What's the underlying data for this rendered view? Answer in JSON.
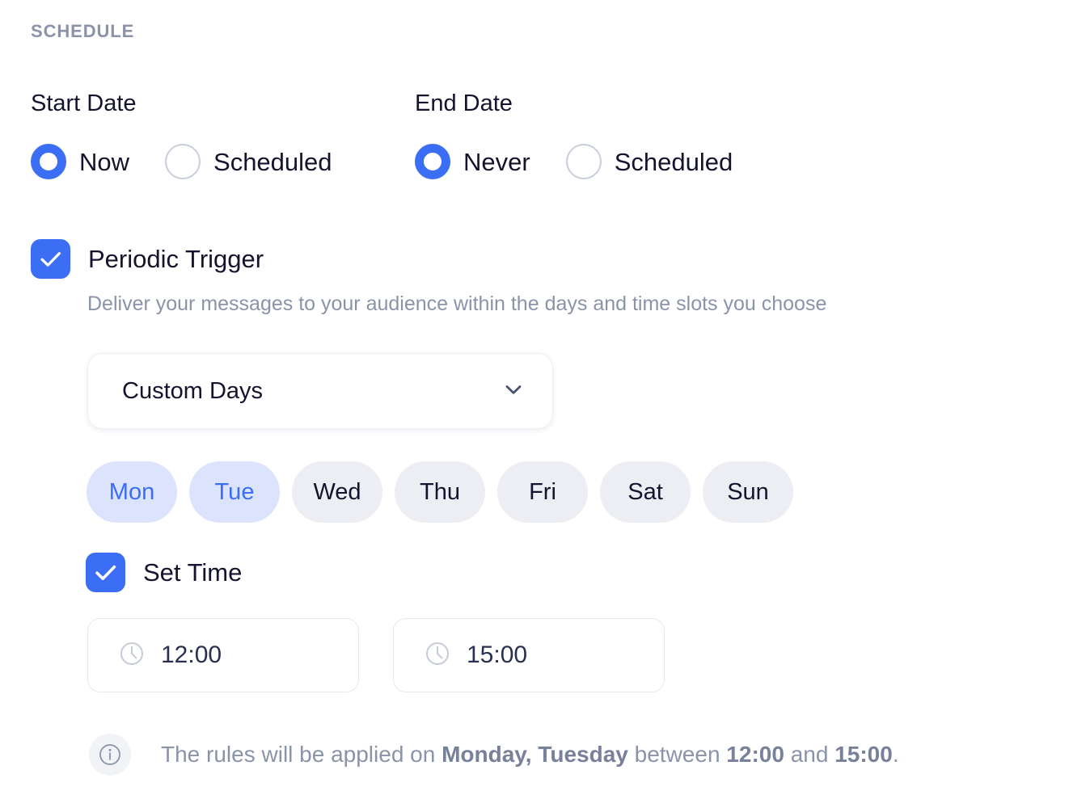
{
  "section": {
    "title": "SCHEDULE"
  },
  "start_date": {
    "label": "Start Date",
    "options": [
      {
        "label": "Now",
        "selected": true
      },
      {
        "label": "Scheduled",
        "selected": false
      }
    ]
  },
  "end_date": {
    "label": "End Date",
    "options": [
      {
        "label": "Never",
        "selected": true
      },
      {
        "label": "Scheduled",
        "selected": false
      }
    ]
  },
  "periodic_trigger": {
    "label": "Periodic Trigger",
    "checked": true,
    "description": "Deliver your messages to your audience within the days and time slots you choose"
  },
  "days_mode": {
    "value": "Custom Days",
    "chevron_icon": "chevron-down-icon"
  },
  "days": [
    {
      "label": "Mon",
      "selected": true
    },
    {
      "label": "Tue",
      "selected": true
    },
    {
      "label": "Wed",
      "selected": false
    },
    {
      "label": "Thu",
      "selected": false
    },
    {
      "label": "Fri",
      "selected": false
    },
    {
      "label": "Sat",
      "selected": false
    },
    {
      "label": "Sun",
      "selected": false
    }
  ],
  "set_time": {
    "label": "Set Time",
    "checked": true,
    "start": {
      "value": "12:00",
      "icon": "clock-icon"
    },
    "end": {
      "value": "15:00",
      "icon": "clock-icon"
    }
  },
  "note": {
    "icon": "info-icon",
    "prefix": "The rules will be applied on ",
    "days": "Monday, Tuesday",
    "middle": " between ",
    "start_time": "12:00",
    "conjunction": " and ",
    "end_time": "15:00",
    "suffix": "."
  },
  "colors": {
    "accent": "#3b6ef5",
    "pill_selected_bg": "#dbe3fd",
    "pill_bg": "#eceef3",
    "muted_text": "#8a93a8",
    "text": "#14142e"
  }
}
